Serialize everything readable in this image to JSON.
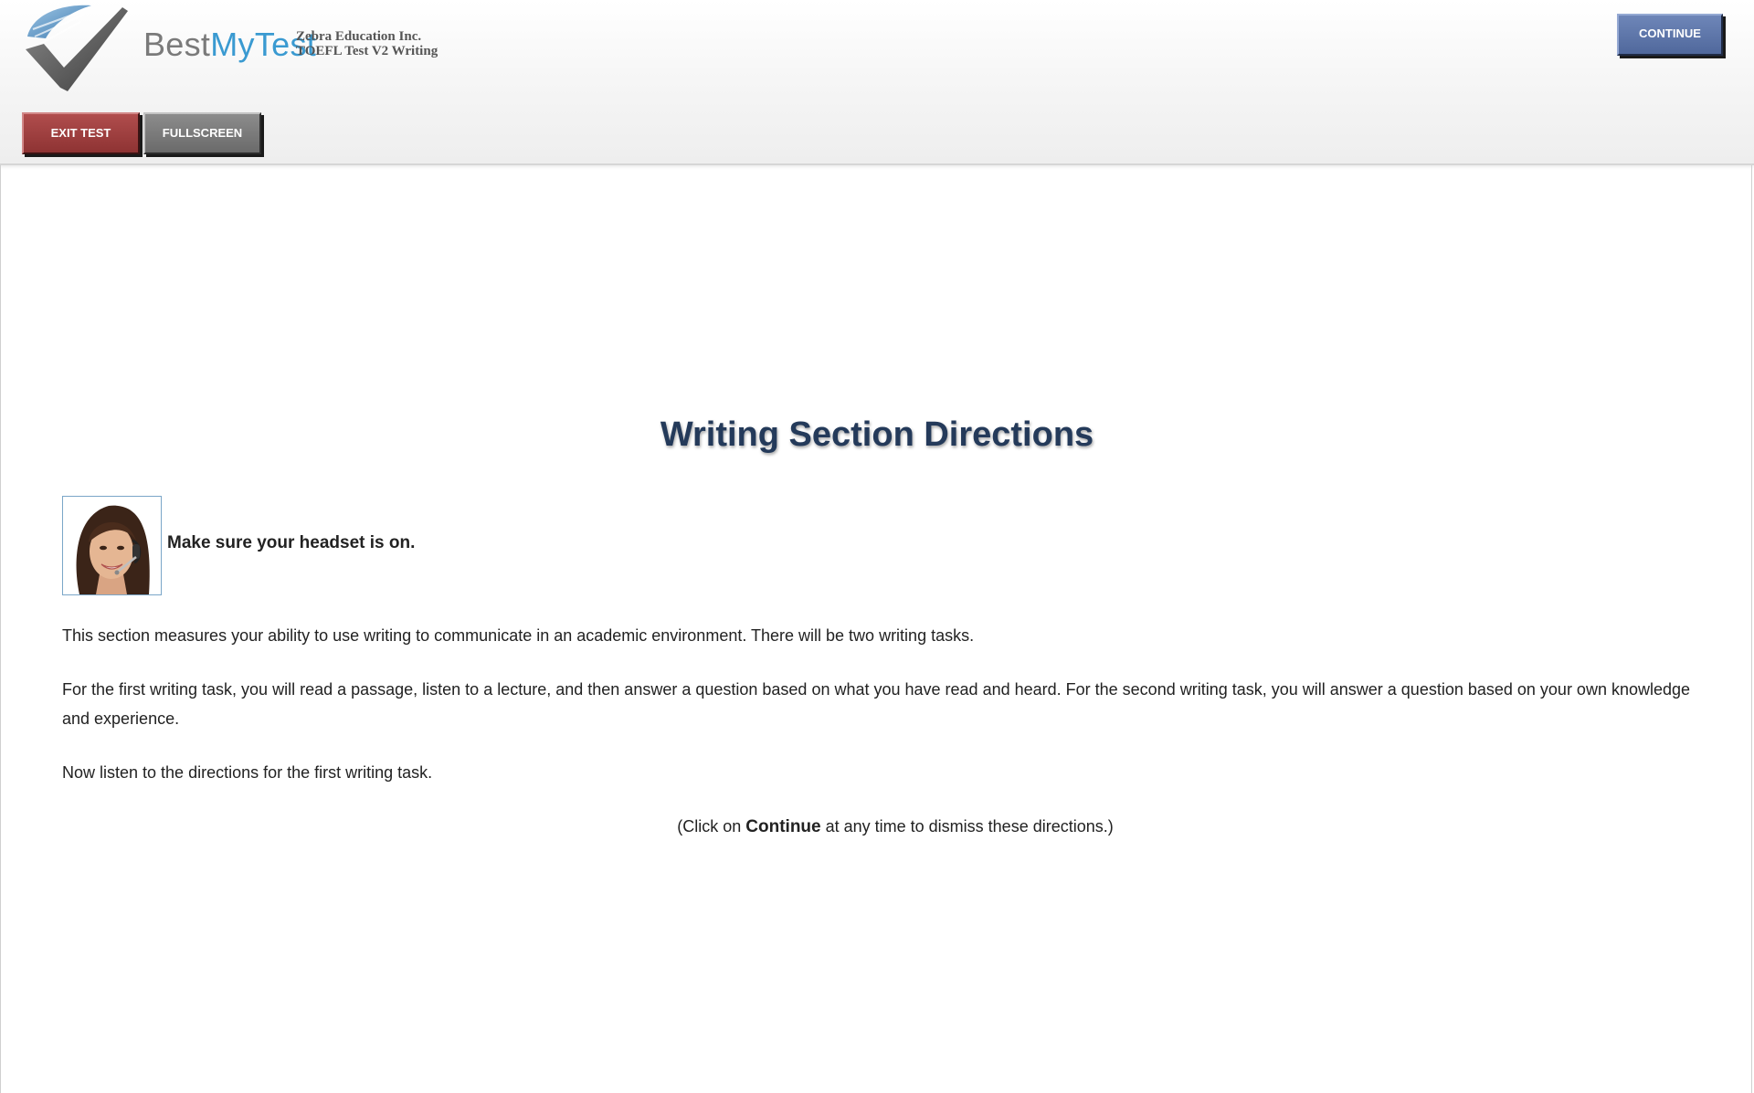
{
  "header": {
    "logo": {
      "part1": "Best",
      "part2": "MyTest"
    },
    "org_name": "Zebra Education Inc.",
    "test_name": "TOEFL Test V2 Writing",
    "continue_label": "CONTINUE",
    "exit_label": "EXIT TEST",
    "fullscreen_label": "FULLSCREEN"
  },
  "main": {
    "title": "Writing Section Directions",
    "headset_text": "Make sure your headset is on.",
    "paragraphs": [
      "This section measures your ability to use writing to communicate in an academic environment. There will be two writing tasks.",
      "For the first writing task, you will read a passage, listen to a lecture, and then answer a question based on what you have read and heard. For the second writing task, you will answer a question based on your own knowledge and experience.",
      "Now listen to the directions for the first writing task."
    ],
    "note": {
      "prefix": "(Click on ",
      "bold": "Continue",
      "suffix": " at any time to dismiss these directions.)"
    }
  },
  "colors": {
    "title": "#243a5a",
    "continue_button": "#5a73a8",
    "exit_button": "#9b3e3e",
    "fullscreen_button": "#7a7a7a",
    "logo_blue": "#3a9ad1"
  },
  "icons": [
    "checkmark-logo-icon",
    "operator-headset-photo"
  ]
}
